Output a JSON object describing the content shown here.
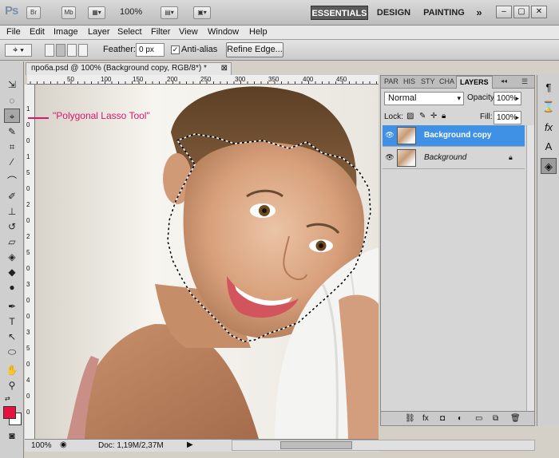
{
  "appbar": {
    "logo": "Ps",
    "bridge": "Br",
    "minibridge": "Mb",
    "zoom": "100%",
    "workspaces": [
      "ESSENTIALS",
      "DESIGN",
      "PAINTING"
    ],
    "more": "»"
  },
  "menu": [
    "File",
    "Edit",
    "Image",
    "Layer",
    "Select",
    "Filter",
    "View",
    "Window",
    "Help"
  ],
  "options": {
    "feather_label": "Feather:",
    "feather_value": "0 px",
    "antialias_label": "Anti-alias",
    "antialias_checked": true,
    "refine_edge": "Refine Edge..."
  },
  "document": {
    "tab_title": "проба.psd @ 100% (Background copy, RGB/8*) *",
    "callout": "\"Polygonal Lasso Tool\"",
    "ruler_top": [
      "50",
      "100",
      "150",
      "200",
      "250",
      "300",
      "350",
      "400",
      "450"
    ],
    "ruler_left": [
      "1",
      "0",
      "0",
      "1",
      "5",
      "0",
      "2",
      "0",
      "2",
      "5",
      "0",
      "3",
      "0",
      "0",
      "3",
      "5",
      "0",
      "4",
      "0",
      "0"
    ],
    "status_zoom": "100%",
    "status_doc": "Doc: 1,19M/2,37M"
  },
  "panel": {
    "tabs": [
      "PAR",
      "HIS",
      "STY",
      "CHA",
      "LAYERS"
    ],
    "active_tab": "LAYERS",
    "blend_mode": "Normal",
    "opacity_label": "Opacity:",
    "opacity_value": "100%",
    "lock_label": "Lock:",
    "fill_label": "Fill:",
    "fill_value": "100%",
    "layers": [
      {
        "name": "Background copy",
        "selected": true
      },
      {
        "name": "Background",
        "selected": false
      }
    ]
  },
  "colors": {
    "foreground": "#e8103e",
    "background": "#ffffff",
    "accent": "#3f91e5",
    "callout": "#d6176a"
  }
}
